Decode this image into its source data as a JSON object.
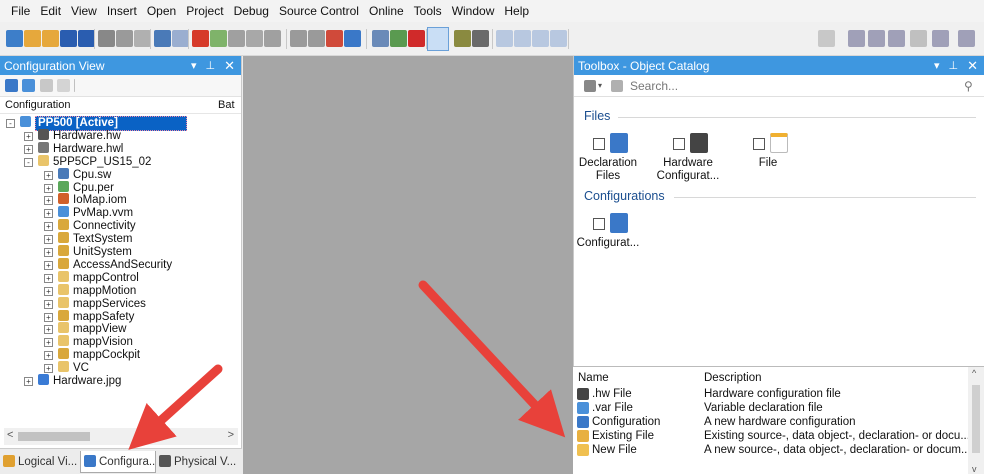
{
  "menu": [
    "File",
    "Edit",
    "View",
    "Insert",
    "Open",
    "Project",
    "Debug",
    "Source Control",
    "Online",
    "Tools",
    "Window",
    "Help"
  ],
  "colors": {
    "accent": "#3e97e0",
    "selection": "#0a62c5",
    "arrow": "#e8413a",
    "editor_bg": "#a6a6a6"
  },
  "config_view": {
    "title": "Configuration View",
    "header_col1": "Configuration",
    "header_col2": "Bat",
    "tree": [
      {
        "label": "PP500 [Active]",
        "icon": "pp500-config-icon",
        "level": 0,
        "selected": true,
        "expander": "-"
      },
      {
        "label": "Hardware.hw",
        "icon": "hardware-icon",
        "level": 1,
        "expander": "+"
      },
      {
        "label": "Hardware.hwl",
        "icon": "hardware-list-icon",
        "level": 1,
        "expander": "+"
      },
      {
        "label": "5PP5CP_US15_02",
        "icon": "cpu-folder-icon",
        "level": 1,
        "expander": "-"
      },
      {
        "label": "Cpu.sw",
        "icon": "software-icon",
        "level": 2,
        "expander": "+"
      },
      {
        "label": "Cpu.per",
        "icon": "permanent-icon",
        "level": 2,
        "expander": "+"
      },
      {
        "label": "IoMap.iom",
        "icon": "iomap-icon",
        "level": 2,
        "expander": "+"
      },
      {
        "label": "PvMap.vvm",
        "icon": "pvmap-icon",
        "level": 2,
        "expander": "+"
      },
      {
        "label": "Connectivity",
        "icon": "connectivity-folder-icon",
        "level": 2,
        "expander": "+"
      },
      {
        "label": "TextSystem",
        "icon": "textsystem-folder-icon",
        "level": 2,
        "expander": "+"
      },
      {
        "label": "UnitSystem",
        "icon": "unitsystem-folder-icon",
        "level": 2,
        "expander": "+"
      },
      {
        "label": "AccessAndSecurity",
        "icon": "security-folder-icon",
        "level": 2,
        "expander": "+"
      },
      {
        "label": "mappControl",
        "icon": "folder-icon",
        "level": 2,
        "expander": "+"
      },
      {
        "label": "mappMotion",
        "icon": "folder-icon",
        "level": 2,
        "expander": "+"
      },
      {
        "label": "mappServices",
        "icon": "folder-icon",
        "level": 2,
        "expander": "+"
      },
      {
        "label": "mappSafety",
        "icon": "safety-folder-icon",
        "level": 2,
        "expander": "+"
      },
      {
        "label": "mappView",
        "icon": "folder-icon",
        "level": 2,
        "expander": "+"
      },
      {
        "label": "mappVision",
        "icon": "folder-icon",
        "level": 2,
        "expander": "+"
      },
      {
        "label": "mappCockpit",
        "icon": "cockpit-folder-icon",
        "level": 2,
        "expander": "+"
      },
      {
        "label": "VC",
        "icon": "folder-icon",
        "level": 2,
        "expander": "+"
      },
      {
        "label": "Hardware.jpg",
        "icon": "image-file-icon",
        "level": 1,
        "expander": "+"
      }
    ],
    "tabs": [
      {
        "label": "Logical Vi...",
        "icon": "logical-view-icon",
        "selected": false
      },
      {
        "label": "Configura...",
        "icon": "configuration-view-icon",
        "selected": true
      },
      {
        "label": "Physical V...",
        "icon": "physical-view-icon",
        "selected": false
      }
    ]
  },
  "toolbox": {
    "title": "Toolbox - Object Catalog",
    "search_placeholder": "Search...",
    "sections": [
      {
        "title": "Files",
        "items": [
          {
            "label": "Declaration\nFiles",
            "icon": "declaration-file-icon"
          },
          {
            "label": "Hardware\nConfigurat...",
            "icon": "hardware-config-icon"
          },
          {
            "label": "File",
            "icon": "new-file-icon"
          }
        ]
      },
      {
        "title": "Configurations",
        "items": [
          {
            "label": "Configurat...",
            "icon": "configuration-icon"
          }
        ]
      }
    ]
  },
  "details": {
    "col_name": "Name",
    "col_desc": "Description",
    "rows": [
      {
        "name": ".hw File",
        "desc": "Hardware configuration file",
        "icon": "hw-file-icon"
      },
      {
        "name": ".var File",
        "desc": "Variable declaration file",
        "icon": "var-file-icon"
      },
      {
        "name": "Configuration",
        "desc": "A new hardware configuration",
        "icon": "configuration-icon"
      },
      {
        "name": "Existing File",
        "desc": "Existing source-, data object-, declaration- or docu...",
        "icon": "existing-file-icon"
      },
      {
        "name": "New File",
        "desc": "A new source-, data object-, declaration- or docum...",
        "icon": "new-file-icon"
      }
    ]
  }
}
